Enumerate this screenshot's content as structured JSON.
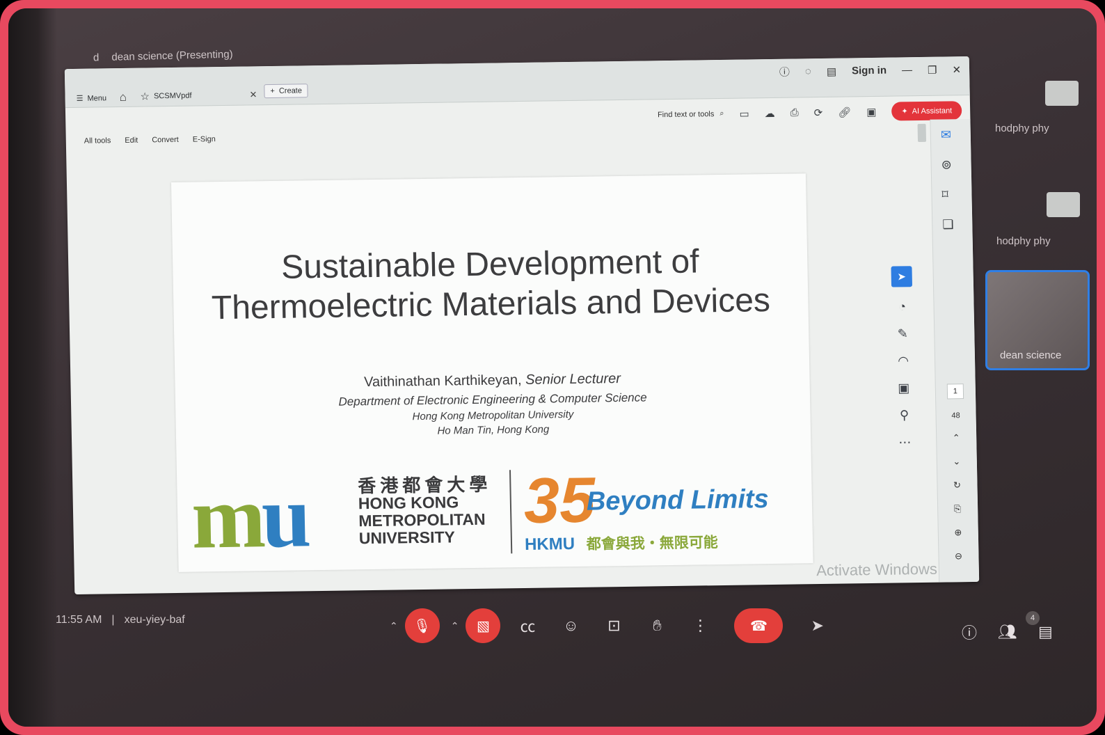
{
  "meeting": {
    "presenter_label": "dean science (Presenting)",
    "presenter_initial": "d",
    "time": "11:55 AM",
    "separator": "|",
    "meeting_code": "xeu-yiey-baf",
    "people_count": "4"
  },
  "participants": [
    {
      "name": "hodphy phy"
    },
    {
      "name": "hodphy phy"
    },
    {
      "name": "dean science"
    }
  ],
  "acrobat": {
    "menu_label": "Menu",
    "file_tab": "SCSMVpdf",
    "create_label": "Create",
    "signin": "Sign in",
    "find_placeholder": "Find text or tools",
    "ai_assistant": "AI Assistant",
    "menu_row": [
      "All tools",
      "Edit",
      "Convert",
      "E-Sign"
    ],
    "page_current": "1",
    "page_total": "48",
    "watermark": "Activate Windows"
  },
  "slide": {
    "title_line1": "Sustainable Development of",
    "title_line2": "Thermoelectric Materials and Devices",
    "author_name": "Vaithinathan Karthikeyan,",
    "author_role": "Senior Lecturer",
    "department": "Department of Electronic Engineering & Computer Science",
    "university": "Hong Kong Metropolitan University",
    "location": "Ho Man Tin, Hong Kong",
    "logo_chinese": "香港都會大學",
    "logo_line1": "HONG KONG",
    "logo_line2": "METROPOLITAN",
    "logo_line3": "UNIVERSITY",
    "anniv_number": "35",
    "anniv_beyond": "Beyond",
    "anniv_limits": "Limits",
    "anniv_hkmu": "HKMU",
    "anniv_slogan": "都會與我・無限可能"
  },
  "colors": {
    "frame": "#e8495f",
    "hangup": "#e33f3b",
    "accent_blue": "#2f7fe6",
    "logo_green": "#8aa83a",
    "logo_blue": "#2f7fc1",
    "anniv_orange": "#e6862f"
  }
}
